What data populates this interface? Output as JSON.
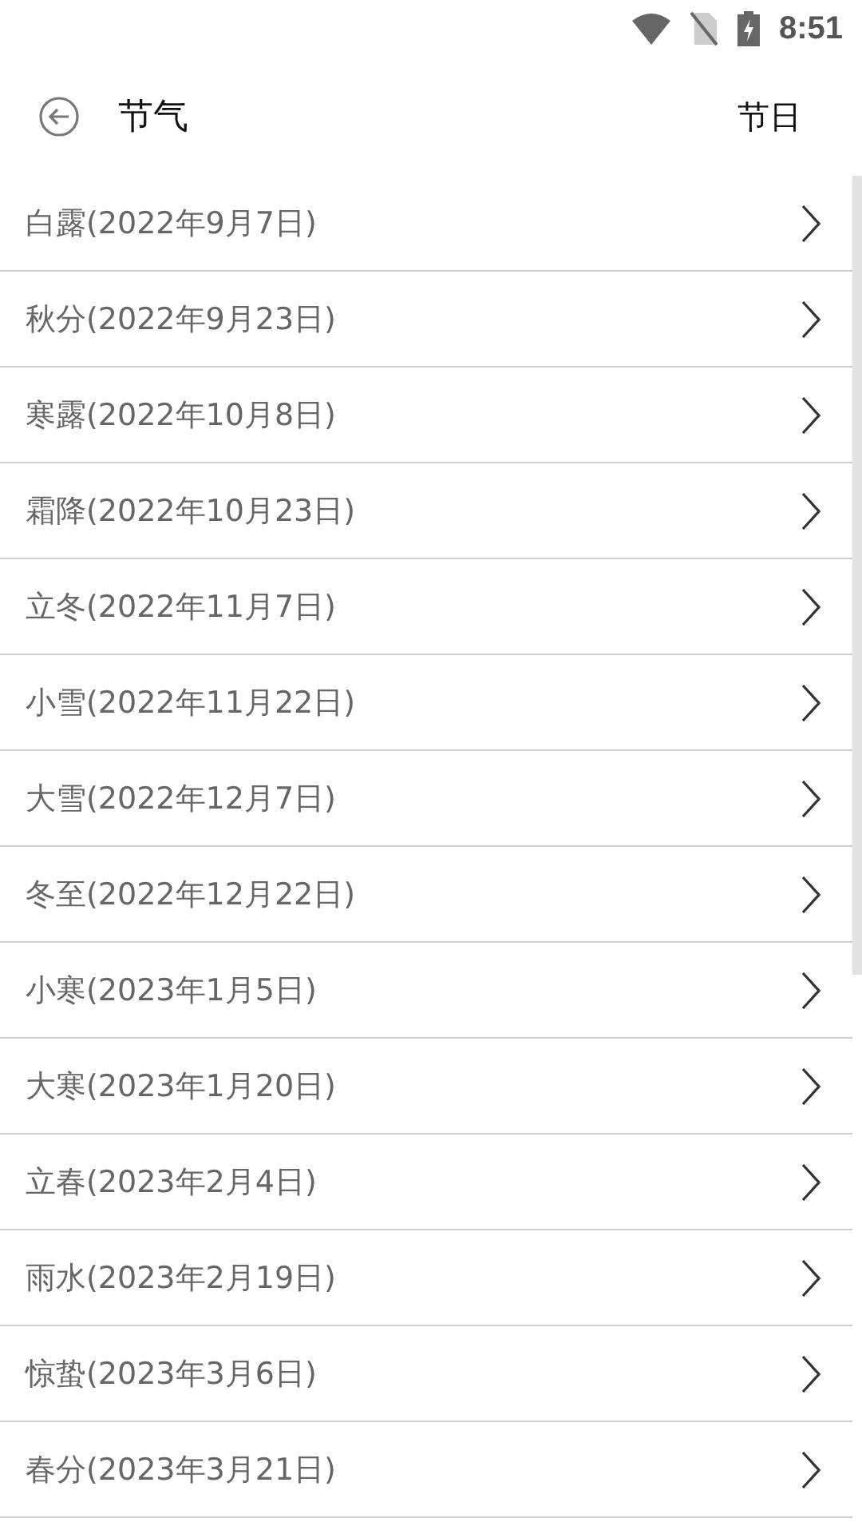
{
  "status_bar": {
    "time": "8:51"
  },
  "header": {
    "title": "节气",
    "action": "节日"
  },
  "items": [
    {
      "label": "白露(2022年9月7日)"
    },
    {
      "label": "秋分(2022年9月23日)"
    },
    {
      "label": "寒露(2022年10月8日)"
    },
    {
      "label": "霜降(2022年10月23日)"
    },
    {
      "label": "立冬(2022年11月7日)"
    },
    {
      "label": "小雪(2022年11月22日)"
    },
    {
      "label": "大雪(2022年12月7日)"
    },
    {
      "label": "冬至(2022年12月22日)"
    },
    {
      "label": "小寒(2023年1月5日)"
    },
    {
      "label": "大寒(2023年1月20日)"
    },
    {
      "label": "立春(2023年2月4日)"
    },
    {
      "label": "雨水(2023年2月19日)"
    },
    {
      "label": "惊蛰(2023年3月6日)"
    },
    {
      "label": "春分(2023年3月21日)"
    }
  ]
}
